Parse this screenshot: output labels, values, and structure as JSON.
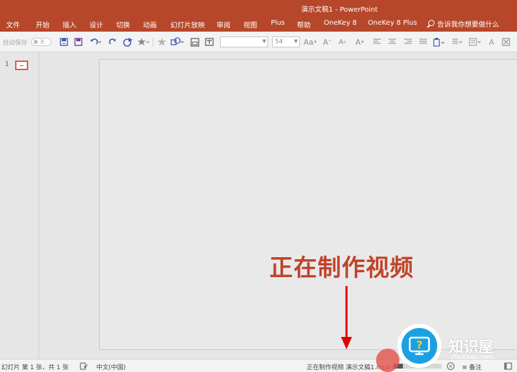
{
  "app": {
    "document_title": "演示文稿1",
    "app_name": "PowerPoint",
    "title_separator": "-"
  },
  "colors": {
    "ribbon": "#b7472a",
    "accent_red": "#c0432a",
    "watermark_blue": "#1ba1e2"
  },
  "ribbon_tabs": [
    {
      "label": "文件"
    },
    {
      "label": "开始"
    },
    {
      "label": "插入"
    },
    {
      "label": "设计"
    },
    {
      "label": "切换"
    },
    {
      "label": "动画"
    },
    {
      "label": "幻灯片放映"
    },
    {
      "label": "审阅"
    },
    {
      "label": "视图"
    },
    {
      "label": "Plus"
    },
    {
      "label": "帮助"
    },
    {
      "label": "OneKey 8"
    },
    {
      "label": "OneKey 8 Plus"
    }
  ],
  "tell_me": {
    "icon": "search-icon",
    "placeholder": "告诉我你想要做什么"
  },
  "toolbar": {
    "autosave_label": "自动保存",
    "autosave_state": "关",
    "font_name_value": "",
    "font_size_value": "54",
    "font_icons": {
      "change_case": "Aa",
      "grow": "A",
      "shrink": "A",
      "font_color": "A"
    }
  },
  "thumbnail_pane": {
    "slide_number": "1"
  },
  "annotation": {
    "text": "正在制作视频"
  },
  "status_bar": {
    "slide_info": "幻灯片 第 1 张，共 1 张",
    "language": "中文(中国)",
    "export_status": "正在制作视频 演示文稿1.mp4",
    "export_progress": 0.2,
    "notes_label": "备注"
  },
  "watermark": {
    "brand": "知识屋",
    "domain": "zhishiwu.com",
    "badge_glyph": "?"
  }
}
